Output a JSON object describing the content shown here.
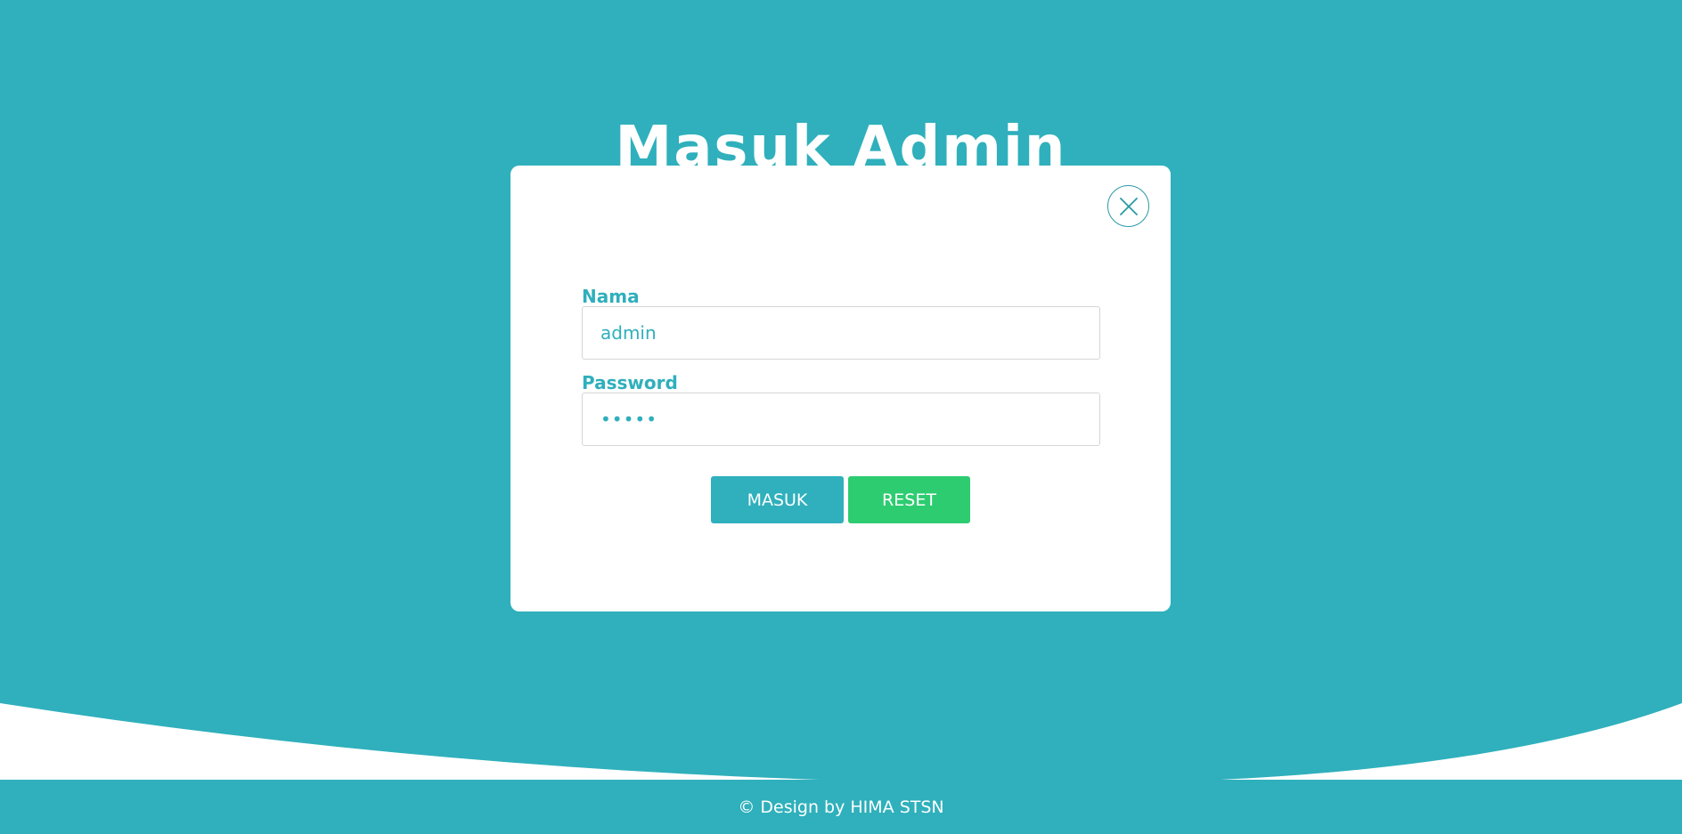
{
  "page": {
    "title": "Masuk Admin"
  },
  "colors": {
    "primary": "#2fb0bc",
    "success": "#2ecc71",
    "card": "#ffffff"
  },
  "login_form": {
    "close_icon": "close-icon",
    "name_label": "Nama",
    "name_value": "admin",
    "password_label": "Password",
    "password_value": "•••••",
    "submit_label": "MASUK",
    "reset_label": "RESET"
  },
  "footer": {
    "text": "© Design by HIMA STSN"
  }
}
